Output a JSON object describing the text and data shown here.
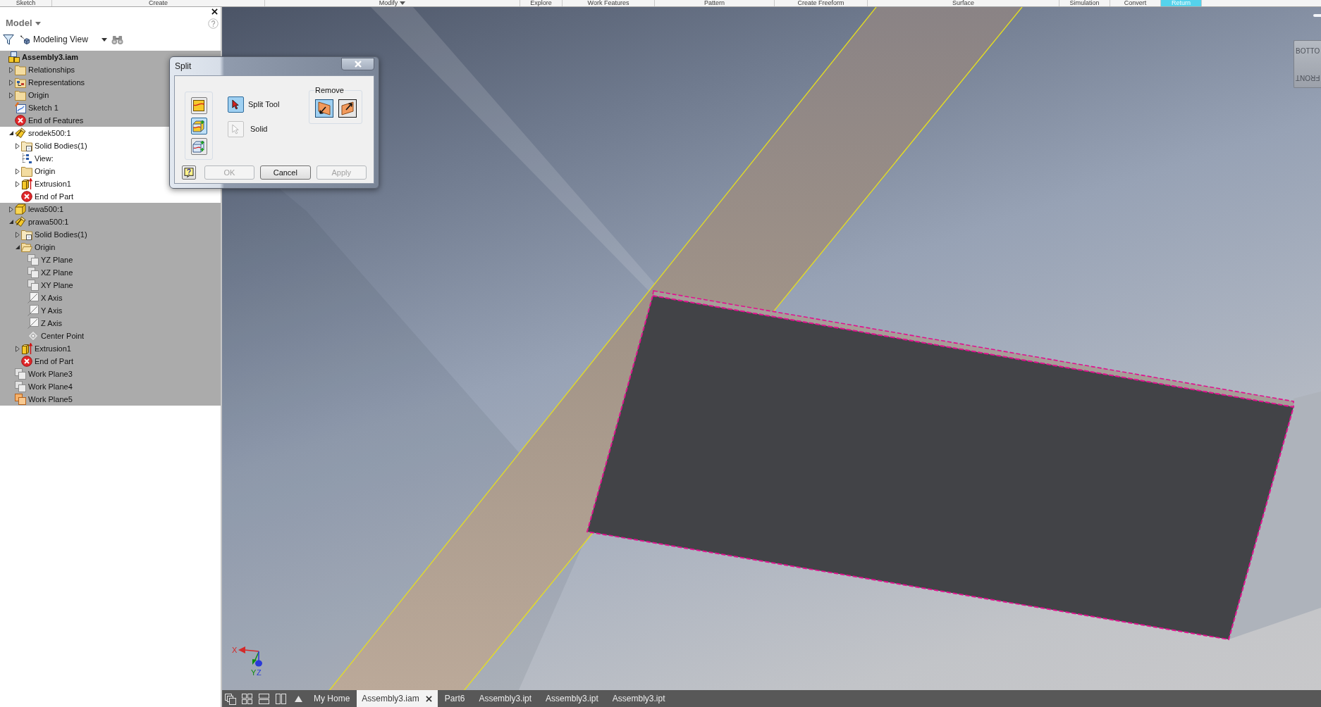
{
  "ribbon": {
    "panels": [
      {
        "label": "Sketch",
        "menu": false,
        "highlighted": false
      },
      {
        "label": "Create",
        "menu": false,
        "highlighted": false
      },
      {
        "label": "Modify",
        "menu": true,
        "highlighted": false
      },
      {
        "label": "Explore",
        "menu": false,
        "highlighted": false
      },
      {
        "label": "Work Features",
        "menu": false,
        "highlighted": false
      },
      {
        "label": "Pattern",
        "menu": false,
        "highlighted": false
      },
      {
        "label": "Create Freeform",
        "menu": false,
        "highlighted": false
      },
      {
        "label": "Surface",
        "menu": false,
        "highlighted": false
      },
      {
        "label": "Simulation",
        "menu": false,
        "highlighted": false
      },
      {
        "label": "Convert",
        "menu": false,
        "highlighted": false
      },
      {
        "label": "Return",
        "menu": false,
        "highlighted": true
      }
    ]
  },
  "browser": {
    "title": "Model",
    "view": "Modeling View",
    "tree": [
      {
        "label": "Assembly3.iam",
        "kind": "assembly",
        "active": false,
        "children": [
          {
            "label": "Relationships",
            "kind": "folder",
            "expanded": false,
            "active": false
          },
          {
            "label": "Representations",
            "kind": "representations",
            "expanded": false,
            "active": false
          },
          {
            "label": "Origin",
            "kind": "folder",
            "expanded": false,
            "active": false
          },
          {
            "label": "Sketch 1",
            "kind": "sketch",
            "active": false
          },
          {
            "label": "End of Features",
            "kind": "end",
            "active": false
          },
          {
            "label": "srodek500:1",
            "kind": "part-edit",
            "expanded": true,
            "active": true,
            "children": [
              {
                "label": "Solid Bodies(1)",
                "kind": "bodies",
                "expanded": false,
                "active": true
              },
              {
                "label": "View:",
                "kind": "view",
                "active": true
              },
              {
                "label": "Origin",
                "kind": "folder",
                "expanded": false,
                "active": true
              },
              {
                "label": "Extrusion1",
                "kind": "extrusion",
                "expanded": false,
                "active": true
              },
              {
                "label": "End of Part",
                "kind": "end",
                "active": true
              }
            ]
          },
          {
            "label": "lewa500:1",
            "kind": "part",
            "expanded": false,
            "active": false
          },
          {
            "label": "prawa500:1",
            "kind": "part-edit",
            "expanded": true,
            "active": false,
            "children": [
              {
                "label": "Solid Bodies(1)",
                "kind": "bodies",
                "expanded": false,
                "active": false
              },
              {
                "label": "Origin",
                "kind": "folder-open",
                "expanded": true,
                "active": false,
                "children": [
                  {
                    "label": "YZ Plane",
                    "kind": "plane",
                    "active": false
                  },
                  {
                    "label": "XZ Plane",
                    "kind": "plane",
                    "active": false
                  },
                  {
                    "label": "XY Plane",
                    "kind": "plane",
                    "active": false
                  },
                  {
                    "label": "X Axis",
                    "kind": "axis",
                    "active": false
                  },
                  {
                    "label": "Y Axis",
                    "kind": "axis",
                    "active": false
                  },
                  {
                    "label": "Z Axis",
                    "kind": "axis",
                    "active": false
                  },
                  {
                    "label": "Center Point",
                    "kind": "point",
                    "active": false
                  }
                ]
              },
              {
                "label": "Extrusion1",
                "kind": "extrusion",
                "expanded": false,
                "active": false
              },
              {
                "label": "End of Part",
                "kind": "end",
                "active": false
              }
            ]
          },
          {
            "label": "Work Plane3",
            "kind": "plane",
            "active": false
          },
          {
            "label": "Work Plane4",
            "kind": "plane",
            "active": false
          },
          {
            "label": "Work Plane5",
            "kind": "plane-shown",
            "active": false
          }
        ]
      }
    ]
  },
  "dialog": {
    "title": "Split",
    "modes": [
      {
        "kind": "face",
        "selected": false
      },
      {
        "kind": "part",
        "selected": true
      },
      {
        "kind": "solid",
        "selected": false
      }
    ],
    "selectors": [
      {
        "label": "Split Tool",
        "selected": true,
        "disabled": false
      },
      {
        "label": "Solid",
        "selected": false,
        "disabled": true
      }
    ],
    "remove": {
      "label": "Remove",
      "options": [
        {
          "kind": "lower",
          "selected": true
        },
        {
          "kind": "upper",
          "selected": false
        }
      ]
    },
    "buttons": [
      {
        "label": "OK",
        "disabled": true
      },
      {
        "label": "Cancel",
        "disabled": false
      },
      {
        "label": "Apply",
        "disabled": true
      }
    ]
  },
  "viewport": {
    "view_cube": {
      "faces": [
        {
          "label": "BOTTO",
          "kind": "upright"
        },
        {
          "label": "FRONT",
          "kind": "inverted"
        }
      ]
    },
    "triad": {
      "axes": [
        {
          "label": "X",
          "color": "#d42a2a"
        },
        {
          "label": "Y",
          "color": "#108c10"
        },
        {
          "label": "Z",
          "color": "#2a3ad8"
        }
      ]
    }
  },
  "document_tabs": [
    {
      "label": "My Home",
      "selected": false
    },
    {
      "label": "Assembly3.iam",
      "selected": true
    },
    {
      "label": "Part6",
      "selected": false
    },
    {
      "label": "Assembly3.ipt",
      "selected": false
    },
    {
      "label": "Assembly3.ipt",
      "selected": false
    },
    {
      "label": "Assembly3.ipt",
      "selected": false
    }
  ]
}
